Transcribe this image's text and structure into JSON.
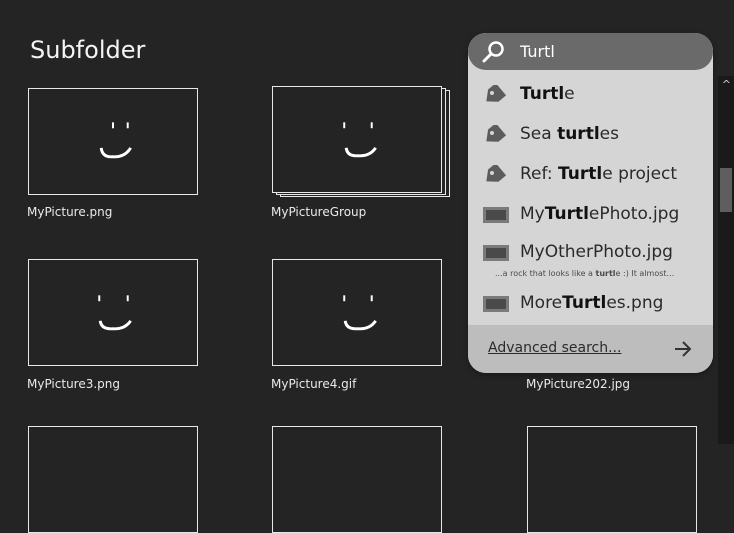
{
  "page": {
    "title": "Subfolder"
  },
  "grid": {
    "items": [
      {
        "caption": "MyPicture.png"
      },
      {
        "caption": "MyPictureGroup"
      },
      {
        "caption": "MyPicture3.png"
      },
      {
        "caption": "MyPicture4.gif"
      },
      {
        "caption": "MyPicture202.jpg"
      }
    ]
  },
  "search": {
    "query": "Turtl",
    "results": [
      {
        "icon": "tag-icon",
        "pre": "",
        "match": "Turtl",
        "post": "e"
      },
      {
        "icon": "tag-icon",
        "pre": "Sea ",
        "match": "turtl",
        "post": "es"
      },
      {
        "icon": "tag-icon",
        "pre": "Ref: ",
        "match": "Turtl",
        "post": "e project"
      },
      {
        "icon": "image-icon",
        "pre": "My",
        "match": "Turtl",
        "post": "ePhoto.jpg"
      },
      {
        "icon": "image-icon",
        "pre": "MyOtherPhoto.jpg",
        "match": "",
        "post": ""
      },
      {
        "icon": "image-icon",
        "pre": "More",
        "match": "Turtl",
        "post": "es.png"
      }
    ],
    "snippet": {
      "pre": "...a rock that looks like a ",
      "match": "turtl",
      "post": "e :) It almost..."
    },
    "advanced_label": "Advanced search..."
  },
  "colors": {
    "background": "#252424",
    "panel": "#d6d5d6",
    "search_bar": "#6b6a6b",
    "footer": "#bebdbe"
  }
}
